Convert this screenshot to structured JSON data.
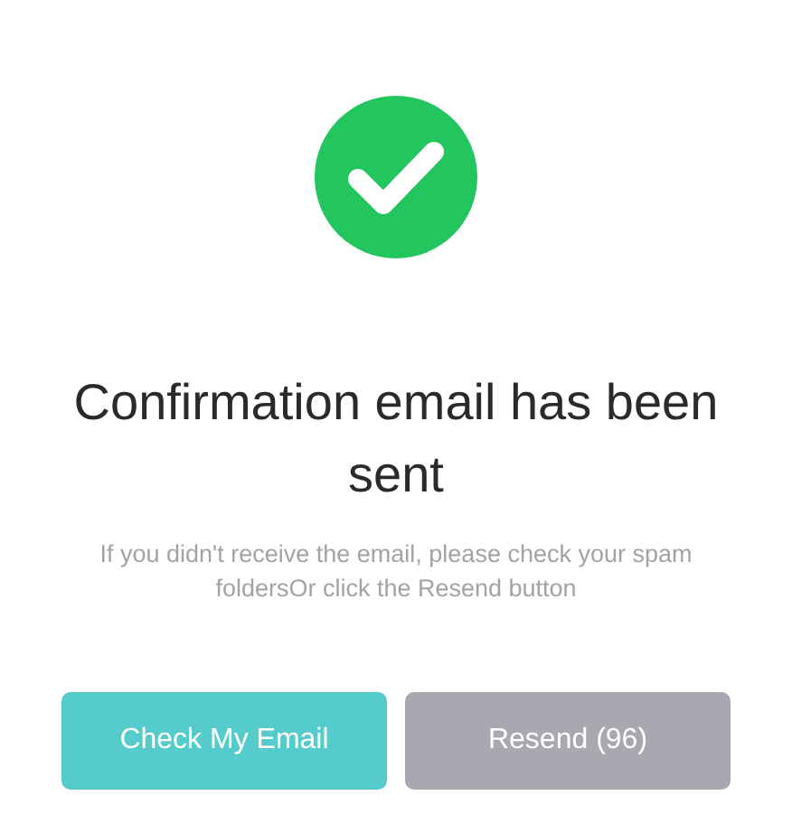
{
  "title": "Confirmation email has been sent",
  "message": "If you didn't receive the email, please check your spam foldersOr click the Resend button",
  "buttons": [
    {
      "label": "Check My Email",
      "disabled": false
    },
    {
      "label": "Resend (96)",
      "disabled": true
    }
  ]
}
